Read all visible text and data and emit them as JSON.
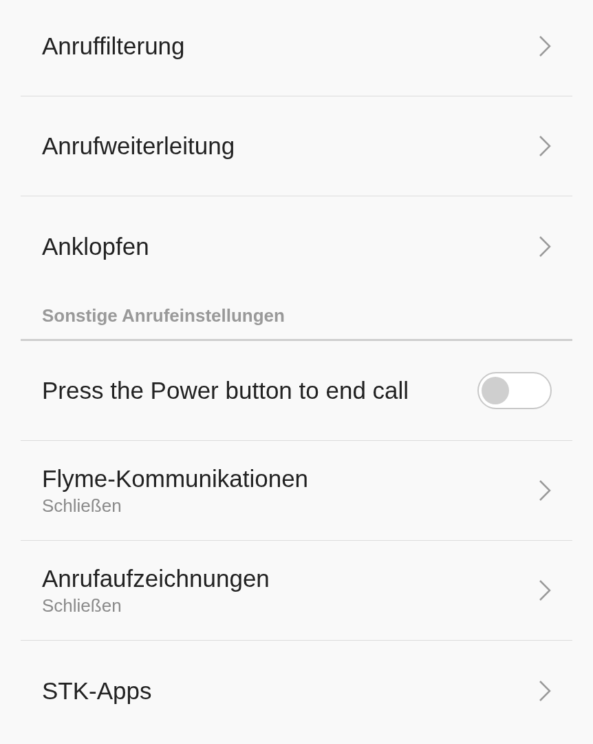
{
  "groups": [
    {
      "items": [
        {
          "kind": "link",
          "title": "Anruffilterung"
        },
        {
          "kind": "link",
          "title": "Anrufweiterleitung"
        },
        {
          "kind": "link",
          "title": "Anklopfen"
        }
      ]
    },
    {
      "header": "Sonstige Anrufeinstellungen",
      "items": [
        {
          "kind": "toggle",
          "title": "Press the Power button to end call",
          "on": false
        },
        {
          "kind": "link",
          "title": "Flyme-Kommunikationen",
          "subtitle": "Schließen"
        },
        {
          "kind": "link",
          "title": "Anrufaufzeichnungen",
          "subtitle": "Schließen"
        },
        {
          "kind": "link",
          "title": "STK-Apps"
        }
      ]
    }
  ]
}
